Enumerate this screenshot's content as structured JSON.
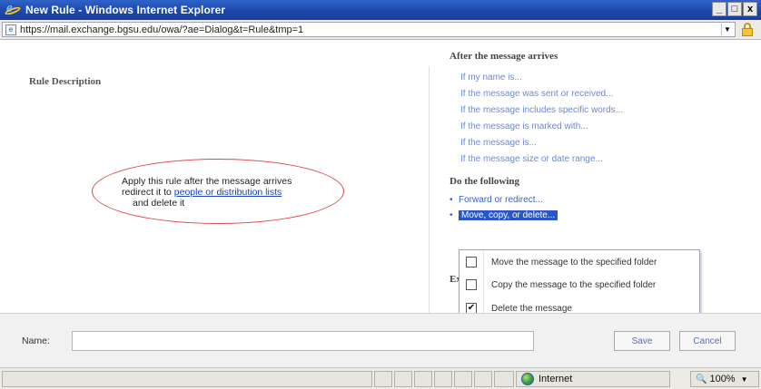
{
  "window": {
    "title": "New Rule - Windows Internet Explorer",
    "buttons": {
      "minimize": "_",
      "maximize": "□",
      "close": "x"
    }
  },
  "address_bar": {
    "url": "https://mail.exchange.bgsu.edu/owa/?ae=Dialog&t=Rule&tmp=1"
  },
  "rule_description": {
    "heading": "Rule Description",
    "line1": "Apply this rule after the message arrives",
    "line2_prefix": "redirect it to ",
    "line2_link": "people or distribution lists",
    "line3": "and delete it"
  },
  "conditions": {
    "heading": "After the message arrives",
    "items": [
      "If my name is...",
      "If the message was sent or received...",
      "If the message includes specific words...",
      "If the message is marked with...",
      "If the message is...",
      "If the message size or date range..."
    ]
  },
  "actions": {
    "heading": "Do the following",
    "items": [
      {
        "label": "Forward or redirect..."
      },
      {
        "label": "Move, copy, or delete..."
      }
    ]
  },
  "exceptions": {
    "label_visible": "Ex"
  },
  "menu": {
    "items": [
      {
        "label": "Move the message to the specified folder",
        "checked": false
      },
      {
        "label": "Copy the message to the specified folder",
        "checked": false
      },
      {
        "label": "Delete the message",
        "checked": true
      }
    ]
  },
  "footer": {
    "name_label": "Name:",
    "name_value": "",
    "save_label": "Save",
    "cancel_label": "Cancel"
  },
  "status_bar": {
    "zone": "Internet",
    "zoom": "100%"
  }
}
